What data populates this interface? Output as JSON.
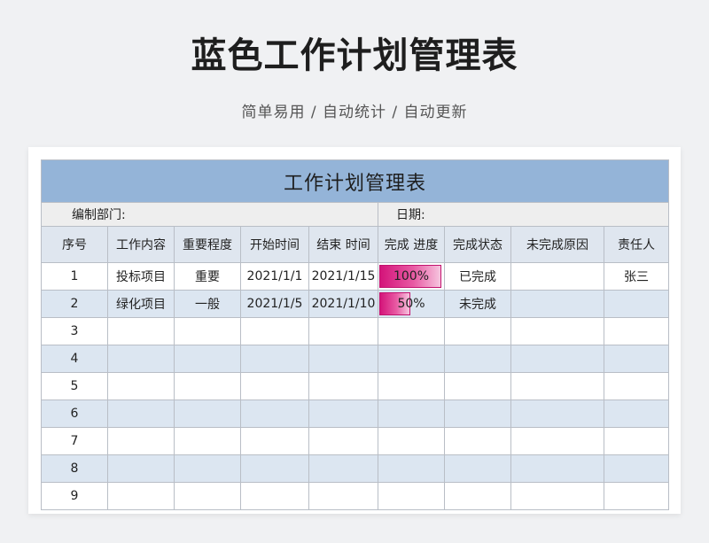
{
  "header": {
    "title": "蓝色工作计划管理表",
    "subtitle": "简单易用 / 自动统计 / 自动更新"
  },
  "sheet": {
    "title": "工作计划管理表",
    "dept_label": "编制部门:",
    "date_label": "日期:",
    "columns": [
      "序号",
      "工作内容",
      "重要程度",
      "开始时间",
      "结束 时间",
      "完成 进度",
      "完成状态",
      "未完成原因",
      "责任人"
    ],
    "rows": [
      {
        "no": "1",
        "task": "投标项目",
        "priority": "重要",
        "start": "2021/1/1",
        "end": "2021/1/15",
        "progress": 1.0,
        "progress_label": "100%",
        "status": "已完成",
        "reason": "",
        "owner": "张三"
      },
      {
        "no": "2",
        "task": "绿化项目",
        "priority": "一般",
        "start": "2021/1/5",
        "end": "2021/1/10",
        "progress": 0.5,
        "progress_label": "50%",
        "status": "未完成",
        "reason": "",
        "owner": ""
      },
      {
        "no": "3",
        "task": "",
        "priority": "",
        "start": "",
        "end": "",
        "progress": 0,
        "progress_label": "",
        "status": "",
        "reason": "",
        "owner": ""
      },
      {
        "no": "4",
        "task": "",
        "priority": "",
        "start": "",
        "end": "",
        "progress": 0,
        "progress_label": "",
        "status": "",
        "reason": "",
        "owner": ""
      },
      {
        "no": "5",
        "task": "",
        "priority": "",
        "start": "",
        "end": "",
        "progress": 0,
        "progress_label": "",
        "status": "",
        "reason": "",
        "owner": ""
      },
      {
        "no": "6",
        "task": "",
        "priority": "",
        "start": "",
        "end": "",
        "progress": 0,
        "progress_label": "",
        "status": "",
        "reason": "",
        "owner": ""
      },
      {
        "no": "7",
        "task": "",
        "priority": "",
        "start": "",
        "end": "",
        "progress": 0,
        "progress_label": "",
        "status": "",
        "reason": "",
        "owner": ""
      },
      {
        "no": "8",
        "task": "",
        "priority": "",
        "start": "",
        "end": "",
        "progress": 0,
        "progress_label": "",
        "status": "",
        "reason": "",
        "owner": ""
      },
      {
        "no": "9",
        "task": "",
        "priority": "",
        "start": "",
        "end": "",
        "progress": 0,
        "progress_label": "",
        "status": "",
        "reason": "",
        "owner": ""
      }
    ]
  },
  "colors": {
    "title_band": "#94b4d8",
    "alt_row": "#dce6f1",
    "progress_bar": "#d4147a"
  }
}
